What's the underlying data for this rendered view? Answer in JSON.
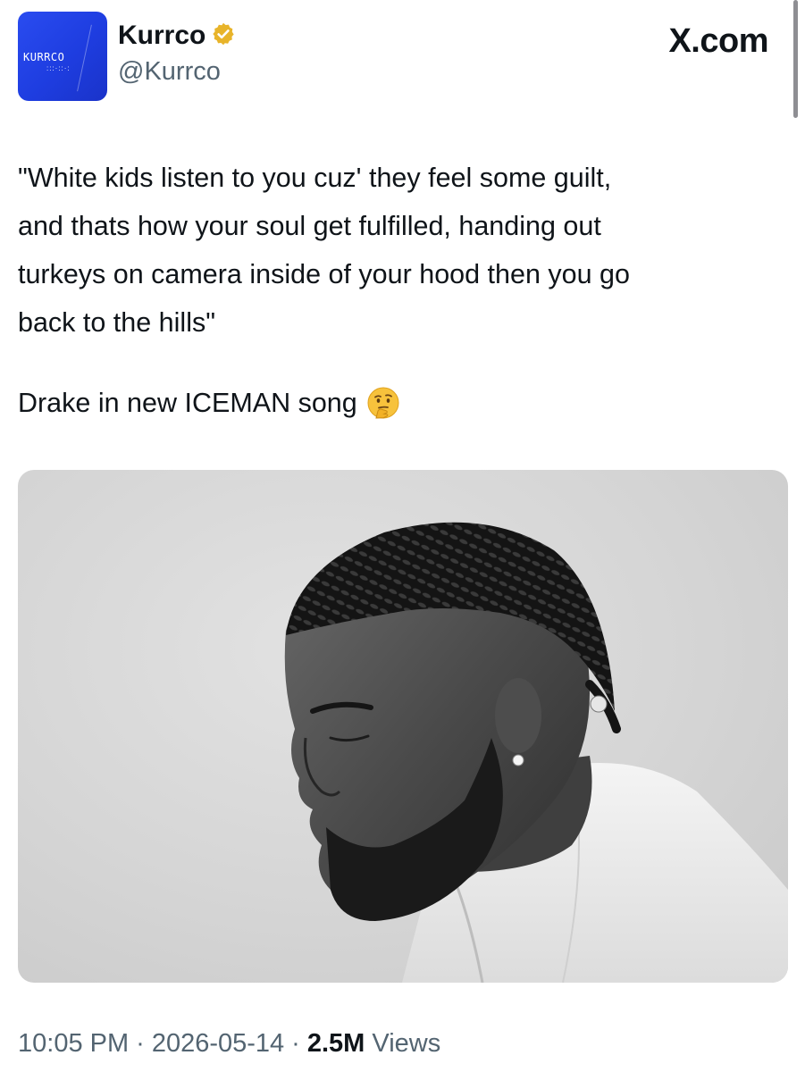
{
  "account": {
    "display_name": "Kurrco",
    "handle": "@Kurrco",
    "verified": true,
    "verified_badge_color": "#e8b42a",
    "avatar_background": "#2347ee",
    "avatar_wordmark": "KURRCO",
    "avatar_dots": ":::·::·:"
  },
  "site": {
    "brand": "X.com"
  },
  "tweet": {
    "text": "\"White kids listen to you cuz' they feel some guilt,\nand thats how your soul get fulfilled, handing out\nturkeys on camera inside of your hood then you go\nback to the hills\"",
    "caption": "Drake in new ICEMAN song",
    "caption_emoji": "thinking-face-icon"
  },
  "media": {
    "type": "black-and-white portrait photo",
    "background_color": "#d6d6d6"
  },
  "meta": {
    "time": "10:05 PM",
    "date": "2026-05-14",
    "views_count": "2.5M",
    "views_label": "Views",
    "separator": "·"
  },
  "colors": {
    "text_primary": "#0f1419",
    "text_secondary": "#536471"
  }
}
